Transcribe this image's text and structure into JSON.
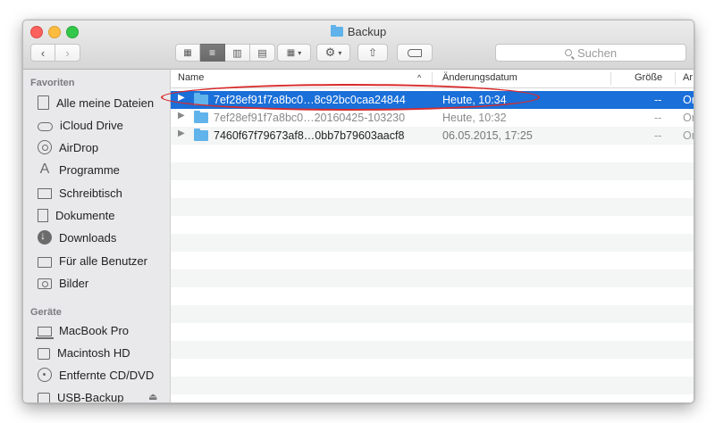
{
  "window": {
    "title": "Backup"
  },
  "toolbar": {
    "back_icon": "chevron-left-icon",
    "forward_icon": "chevron-right-icon",
    "views": [
      "icon-view-icon",
      "list-view-icon",
      "column-view-icon",
      "coverflow-view-icon"
    ],
    "active_view": 1,
    "search_placeholder": "Suchen"
  },
  "sidebar": {
    "favorites_header": "Favoriten",
    "favorites": [
      {
        "label": "Alle meine Dateien",
        "icon": "all-files-icon"
      },
      {
        "label": "iCloud Drive",
        "icon": "cloud-icon"
      },
      {
        "label": "AirDrop",
        "icon": "airdrop-icon"
      },
      {
        "label": "Programme",
        "icon": "applications-icon"
      },
      {
        "label": "Schreibtisch",
        "icon": "desktop-icon"
      },
      {
        "label": "Dokumente",
        "icon": "documents-icon"
      },
      {
        "label": "Downloads",
        "icon": "downloads-icon"
      },
      {
        "label": "Für alle Benutzer",
        "icon": "folder-icon"
      },
      {
        "label": "Bilder",
        "icon": "camera-icon"
      }
    ],
    "devices_header": "Geräte",
    "devices": [
      {
        "label": "MacBook Pro",
        "icon": "laptop-icon"
      },
      {
        "label": "Macintosh HD",
        "icon": "hard-drive-icon"
      },
      {
        "label": "Entfernte CD/DVD",
        "icon": "cd-icon"
      },
      {
        "label": "USB-Backup",
        "icon": "usb-drive-icon"
      }
    ]
  },
  "columns": {
    "name": "Name",
    "date": "Änderungsdatum",
    "size": "Größe",
    "kind": "Ar"
  },
  "rows": [
    {
      "name": "7ef28ef91f7a8bc0…8c92bc0caa24844",
      "date": "Heute, 10:34",
      "size": "--",
      "kind": "Or",
      "selected": true
    },
    {
      "name": "7ef28ef91f7a8bc0…20160425-103230",
      "date": "Heute, 10:32",
      "size": "--",
      "kind": "Or",
      "selected": false
    },
    {
      "name": "7460f67f79673af8…0bb7b79603aacf8",
      "date": "06.05.2015, 17:25",
      "size": "--",
      "kind": "Or",
      "selected": false
    }
  ],
  "colors": {
    "selection": "#1a6fd8",
    "folder": "#61b3eb",
    "annotation": "#d92b2b"
  }
}
